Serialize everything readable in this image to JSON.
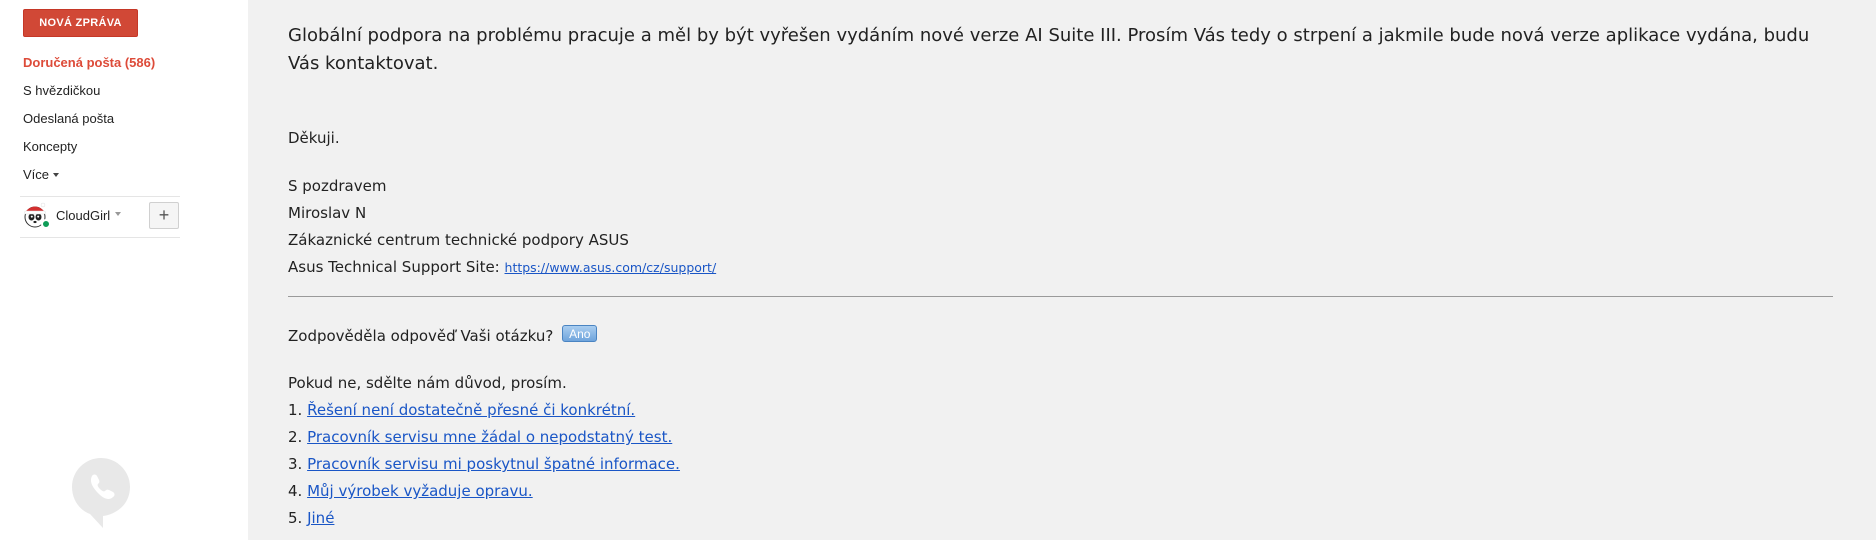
{
  "sidebar": {
    "compose_label": "NOVÁ ZPRÁVA",
    "nav_items": [
      {
        "label": "Doručená pošta (586)",
        "active": true
      },
      {
        "label": "S hvězdičkou",
        "active": false
      },
      {
        "label": "Odeslaná pošta",
        "active": false
      },
      {
        "label": "Koncepty",
        "active": false
      },
      {
        "label": "Více",
        "active": false
      }
    ],
    "hangouts": {
      "user_name": "CloudGirl",
      "status_color": "#0f9d58",
      "add_icon": "plus-icon",
      "add_label": "+"
    },
    "phone_icon": "phone-icon"
  },
  "message": {
    "intro": "Globální podpora na problému pracuje a měl by být vyřešen vydáním nové verze AI Suite III. Prosím Vás tedy o strpení a jakmile bude nová verze aplikace vydána, budu Vás kontaktovat.",
    "thanks": "Děkuji.",
    "signature": {
      "greeting": "S pozdravem",
      "name": "Miroslav N",
      "department": "Zákaznické centrum technické podpory ASUS",
      "site_label": "Asus Technical Support Site:",
      "site_url": "https://www.asus.com/cz/support/"
    },
    "question": "Zodpověděla odpověď Vaši otázku?",
    "yes_label": "Ano",
    "reasons_intro": "Pokud ne, sdělte nám důvod, prosím.",
    "reasons": [
      {
        "num": "1.",
        "text": "Řešení není dostatečně přesné či konkrétní."
      },
      {
        "num": "2.",
        "text": "Pracovník servisu mne žádal o nepodstatný test."
      },
      {
        "num": "3.",
        "text": "Pracovník servisu mi poskytnul špatné informace."
      },
      {
        "num": "4.",
        "text": "Můj výrobek vyžaduje opravu."
      },
      {
        "num": "5.",
        "text": "Jiné"
      }
    ]
  },
  "colors": {
    "compose_bg": "#d14836",
    "active_nav": "#dd4b39",
    "link": "#1a56c6",
    "main_bg": "#f1f1f1"
  }
}
